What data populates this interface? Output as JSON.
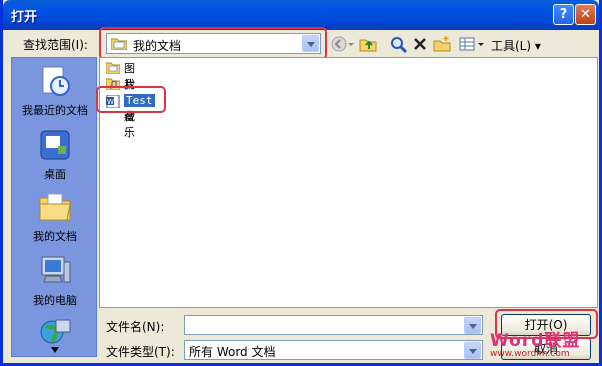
{
  "window": {
    "title": "打开"
  },
  "toolbar": {
    "look_in_label": "查找范围(I):",
    "look_in_value": "我的文档",
    "tools_label": "工具(L)"
  },
  "places": [
    {
      "label": "我最近的文档",
      "icon": "recent-documents-icon"
    },
    {
      "label": "桌面",
      "icon": "desktop-icon"
    },
    {
      "label": "我的文档",
      "icon": "my-documents-icon"
    },
    {
      "label": "我的电脑",
      "icon": "my-computer-icon"
    },
    {
      "label": "",
      "icon": "network-places-icon"
    }
  ],
  "files": [
    {
      "name": "图片收藏",
      "icon": "folder-icon"
    },
    {
      "name": "我的音乐",
      "icon": "music-folder-icon"
    },
    {
      "name": "Test",
      "icon": "word-document-icon",
      "selected": true
    }
  ],
  "form": {
    "filename_label": "文件名(N):",
    "filename_value": "",
    "filetype_label": "文件类型(T):",
    "filetype_value": "所有 Word 文档",
    "open_label": "打开(O)",
    "cancel_label": "取消"
  },
  "watermark": {
    "brand": "Word联盟",
    "url": "www.wordlm.com"
  },
  "colors": {
    "highlight": "#d9344a",
    "selection": "#316ac5",
    "titlebar": "#0055e5"
  }
}
